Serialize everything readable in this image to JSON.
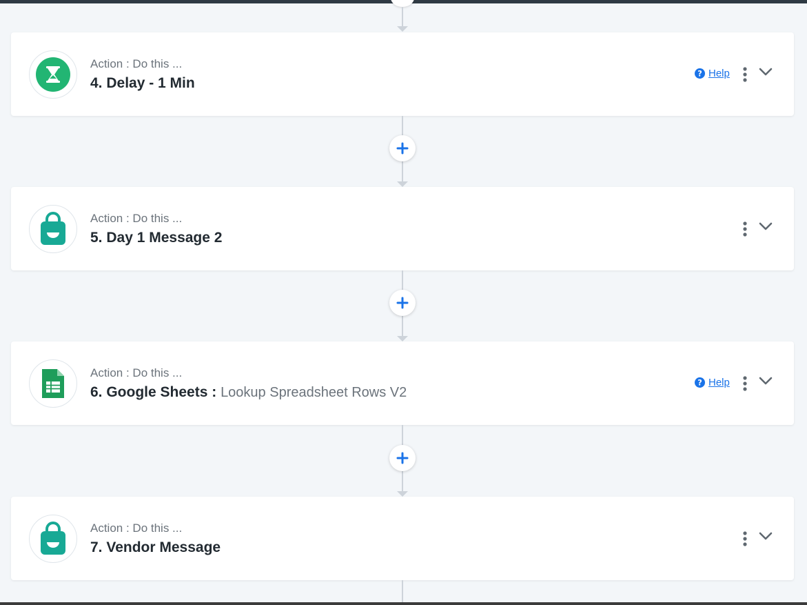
{
  "colors": {
    "accent_blue": "#1a73e8",
    "delay_green": "#22b573",
    "bag_teal": "#18a995",
    "sheets_green": "#1e9d5a"
  },
  "help_label": "Help",
  "steps": [
    {
      "subtitle": "Action : Do this ...",
      "title": "4. Delay - 1 Min",
      "detail": "",
      "icon": "hourglass-icon",
      "has_help": true
    },
    {
      "subtitle": "Action : Do this ...",
      "title": "5. Day 1 Message 2",
      "detail": "",
      "icon": "shopping-bag-icon",
      "has_help": false
    },
    {
      "subtitle": "Action : Do this ...",
      "title": "6. Google Sheets :",
      "detail": "Lookup Spreadsheet Rows V2",
      "icon": "google-sheets-icon",
      "has_help": true
    },
    {
      "subtitle": "Action : Do this ...",
      "title": "7. Vendor Message",
      "detail": "",
      "icon": "shopping-bag-icon",
      "has_help": false
    }
  ]
}
